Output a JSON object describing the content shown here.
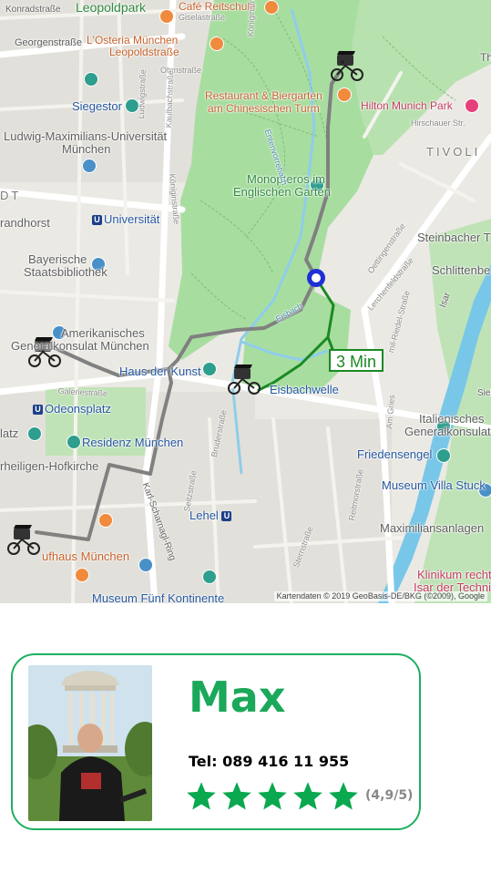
{
  "map": {
    "attribution": "Kartendaten © 2019 GeoBasis-DE/BKG (©2009), Google",
    "eta_label": "3 Min",
    "route_colors": {
      "active": "#1a8a22",
      "inactive": "#808080",
      "destination": "#1e2fd6"
    },
    "labels": {
      "konradsstrasse": "Konradstraße",
      "leopoldpark": "Leopoldpark",
      "cafe_reitschule": "Café Reitschule",
      "georgenstrasse": "Georgenstraße",
      "osteria_1": "L'Osteria München",
      "osteria_2": "Leopoldstraße",
      "ohmstrasse": "Ohmstraße",
      "restaurant_1": "Restaurant & Biergarten",
      "restaurant_2": "am Chinesischen Turm",
      "hilton": "Hilton Munich Park",
      "siegestor": "Siegestor",
      "lmu_1": "Ludwig-Maximilians-Universität",
      "lmu_2": "München",
      "tivoli": "TIVOLI",
      "monopteros_1": "Monopteros im",
      "monopteros_2": "Englischen Garten",
      "dt": "DT",
      "universitaet": "Universität",
      "randhorst": "randhorst",
      "steinbacher": "Steinbacher T",
      "schlittenberg": "Schlittenbe",
      "staatsbib_1": "Bayerische",
      "staatsbib_2": "Staatsbibliothek",
      "amerika_1": "Amerikanisches",
      "amerika_2": "Generalkonsulat München",
      "haus_der_kunst": "Haus der Kunst",
      "eisbachwelle": "Eisbachwelle",
      "odeonsplatz": "Odeonsplatz",
      "residenz": "Residenz München",
      "italienisch_1": "Italienisches",
      "italienisch_2": "Generalkonsulat",
      "friedensengel": "Friedensengel",
      "latz": "latz",
      "hofkirche": "rheiligen-Hofkirche",
      "villa_stuck": "Museum Villa Stuck",
      "lehel": "Lehel",
      "maximiliansanlagen": "Maximiliansanlagen",
      "kaufhaus": "ufhaus München",
      "klinikum_1": "Klinikum recht",
      "klinikum_2": "Isar der Technisc",
      "museum_fuenf": "Museum Fünf Kontinente",
      "isar": "Isar",
      "eisbach": "Eisbach",
      "entenvorrebach": "Entenvorrebach",
      "koeniginstrasse": "Königinstraße",
      "karl_scharnagl": "Karl-Scharnagl-Ring",
      "sternstrasse": "Sternstraße",
      "emil_riedel": "mil-Riedel-Straße",
      "oettingenstrasse": "Oettingenstraße",
      "lerchenfeldstrasse": "Lerchenfeldstraße",
      "reitmorstrasse": "Reitmorstraße",
      "galeriestrasse": "Galeriestraße",
      "bruderstrasse": "Bruderstraße",
      "seitzstrasse": "Seitzstraße",
      "am_gries": "Am Gries",
      "ludwigstrasse": "Ludwigstraße",
      "kaulbachstrasse": "Kaulbachstraße",
      "giselastrasse": "Giselastraße",
      "hirschauer": "Hirschauer Str.",
      "th": "Th",
      "siebe": "Siebe"
    }
  },
  "driver": {
    "name": "Max",
    "phone": "Tel: 089 416 11 955",
    "rating_text": "(4,9/5)",
    "rating_value": 4.9,
    "rating_max": 5,
    "star_color": "#0aa84f"
  }
}
